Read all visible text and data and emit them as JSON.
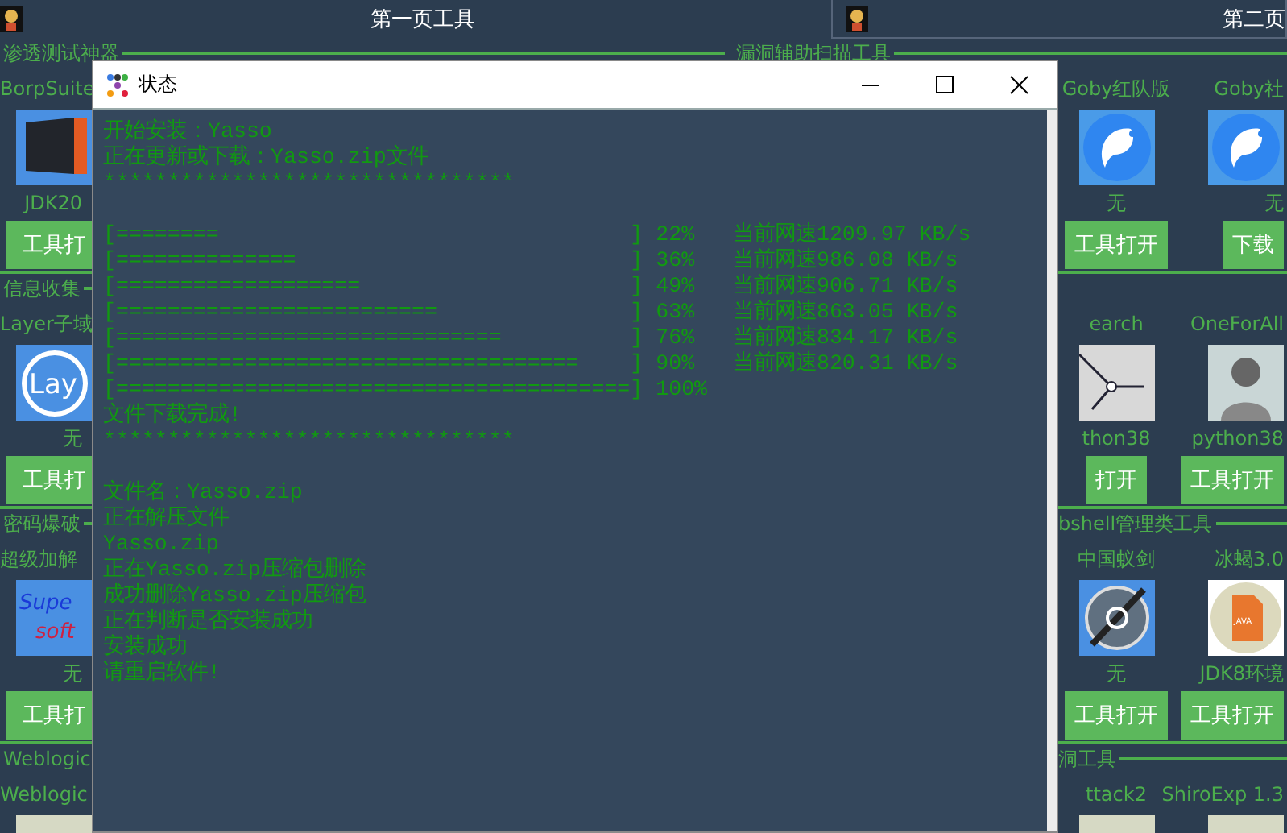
{
  "pages": [
    {
      "title": "第一页工具"
    },
    {
      "title": "第二页"
    }
  ],
  "section_headers": [
    {
      "title": "渗透测试神器"
    },
    {
      "title": "漏洞辅助扫描工具"
    }
  ],
  "left_column": [
    {
      "tools": [
        {
          "kind": "jdk",
          "name": "BorpSuite",
          "caption": "JDK20",
          "button": "工具打"
        }
      ]
    },
    {
      "title": "信息收集",
      "tools": [
        {
          "kind": "layer",
          "logo_text": "Lay",
          "name": "Layer子域",
          "caption": "无",
          "button": "工具打"
        }
      ]
    },
    {
      "title": "密码爆破",
      "tools": [
        {
          "kind": "super",
          "logo_text": "Supe",
          "logo_text_2": "soft",
          "name": "超级加解",
          "caption": "无",
          "button": "工具打"
        }
      ]
    },
    {
      "title": "Weblogic",
      "tools": [
        {
          "kind": "photo",
          "name": "Weblogic"
        }
      ]
    }
  ],
  "right_column": [
    {
      "tools": [
        {
          "kind": "goby",
          "name": "Goby红队版",
          "caption": "无",
          "button": "工具打开"
        },
        {
          "kind": "goby",
          "name": "Goby社",
          "caption": "无",
          "button": "下载"
        }
      ]
    },
    {
      "tools": [
        {
          "kind": "graph",
          "name": "earch",
          "caption": "thon38",
          "button": "打开"
        },
        {
          "kind": "avatar",
          "name": "OneForAll",
          "caption": "python38",
          "button": "工具打开"
        }
      ]
    },
    {
      "title": "bshell管理类工具",
      "tools": [
        {
          "kind": "sword",
          "name": "中国蚁剑",
          "caption": "无",
          "button": "工具打开"
        },
        {
          "kind": "java",
          "logo_text": "JAVA",
          "name": "冰蝎3.0",
          "caption": "JDK8环境",
          "button": "工具打开"
        }
      ]
    },
    {
      "title": "洞工具",
      "tools": [
        {
          "kind": "photo",
          "name": "ttack2"
        },
        {
          "kind": "photo",
          "name": "ShiroExp 1.3"
        }
      ]
    }
  ],
  "dialog": {
    "title": "状态",
    "lines": [
      {
        "kind": "text",
        "text": "开始安装：Yasso"
      },
      {
        "kind": "text",
        "text": "正在更新或下载：Yasso.zip文件"
      },
      {
        "kind": "text",
        "text": "********************************"
      },
      {
        "kind": "gap"
      },
      {
        "kind": "progress",
        "bar": "[========",
        "end": "]",
        "percent": "22%",
        "speed": "当前网速1209.97 KB/s"
      },
      {
        "kind": "progress",
        "bar": "[==============",
        "end": "]",
        "percent": "36%",
        "speed": "当前网速986.08 KB/s"
      },
      {
        "kind": "progress",
        "bar": "[===================",
        "end": "]",
        "percent": "49%",
        "speed": "当前网速906.71 KB/s"
      },
      {
        "kind": "progress",
        "bar": "[=========================",
        "end": "]",
        "percent": "63%",
        "speed": "当前网速863.05 KB/s"
      },
      {
        "kind": "progress",
        "bar": "[==============================",
        "end": "]",
        "percent": "76%",
        "speed": "当前网速834.17 KB/s"
      },
      {
        "kind": "progress",
        "bar": "[====================================",
        "end": "]",
        "percent": "90%",
        "speed": "当前网速820.31 KB/s"
      },
      {
        "kind": "progress",
        "bar": "[========================================]",
        "percent": "100%"
      },
      {
        "kind": "text",
        "text": "文件下载完成!"
      },
      {
        "kind": "text",
        "text": "********************************"
      },
      {
        "kind": "gap"
      },
      {
        "kind": "text",
        "text": "文件名：Yasso.zip"
      },
      {
        "kind": "text",
        "text": "正在解压文件"
      },
      {
        "kind": "text",
        "text": "Yasso.zip"
      },
      {
        "kind": "text",
        "text": "正在Yasso.zip压缩包删除"
      },
      {
        "kind": "text",
        "text": "成功删除Yasso.zip压缩包"
      },
      {
        "kind": "text",
        "text": "正在判断是否安装成功"
      },
      {
        "kind": "text",
        "text": "安装成功"
      },
      {
        "kind": "text",
        "text": "请重启软件!"
      }
    ]
  }
}
